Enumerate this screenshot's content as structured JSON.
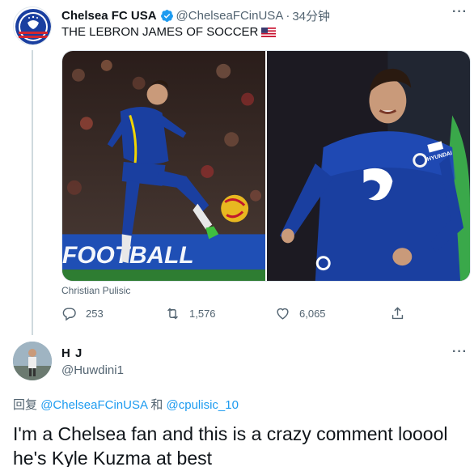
{
  "tweet": {
    "display_name": "Chelsea FC USA",
    "handle": "@ChelseaFCinUSA",
    "separator": "·",
    "time": "34分钟",
    "text": "THE LEBRON JAMES OF SOCCER",
    "flag_icon": "us-flag-icon",
    "photo_left_banner": "FOOTBALL",
    "caption": "Christian Pulisic",
    "stats": {
      "replies": "253",
      "retweets": "1,576",
      "likes": "6,065"
    },
    "more": "···"
  },
  "reply": {
    "display_name": "H J",
    "handle": "@Huwdini1",
    "reply_prefix": "回复",
    "reply_user_1": "@ChelseaFCinUSA",
    "reply_and": "和",
    "reply_user_2": "@cpulisic_10",
    "text": "I'm a Chelsea fan and this is a crazy comment looool he's Kyle Kuzma at best",
    "more": "···"
  },
  "colors": {
    "verified": "#1d9bf0",
    "link": "#1d9bf0",
    "secondary_text": "#536471",
    "thread_line": "#cfd9de",
    "chelsea_blue": "#1a3fa0"
  }
}
